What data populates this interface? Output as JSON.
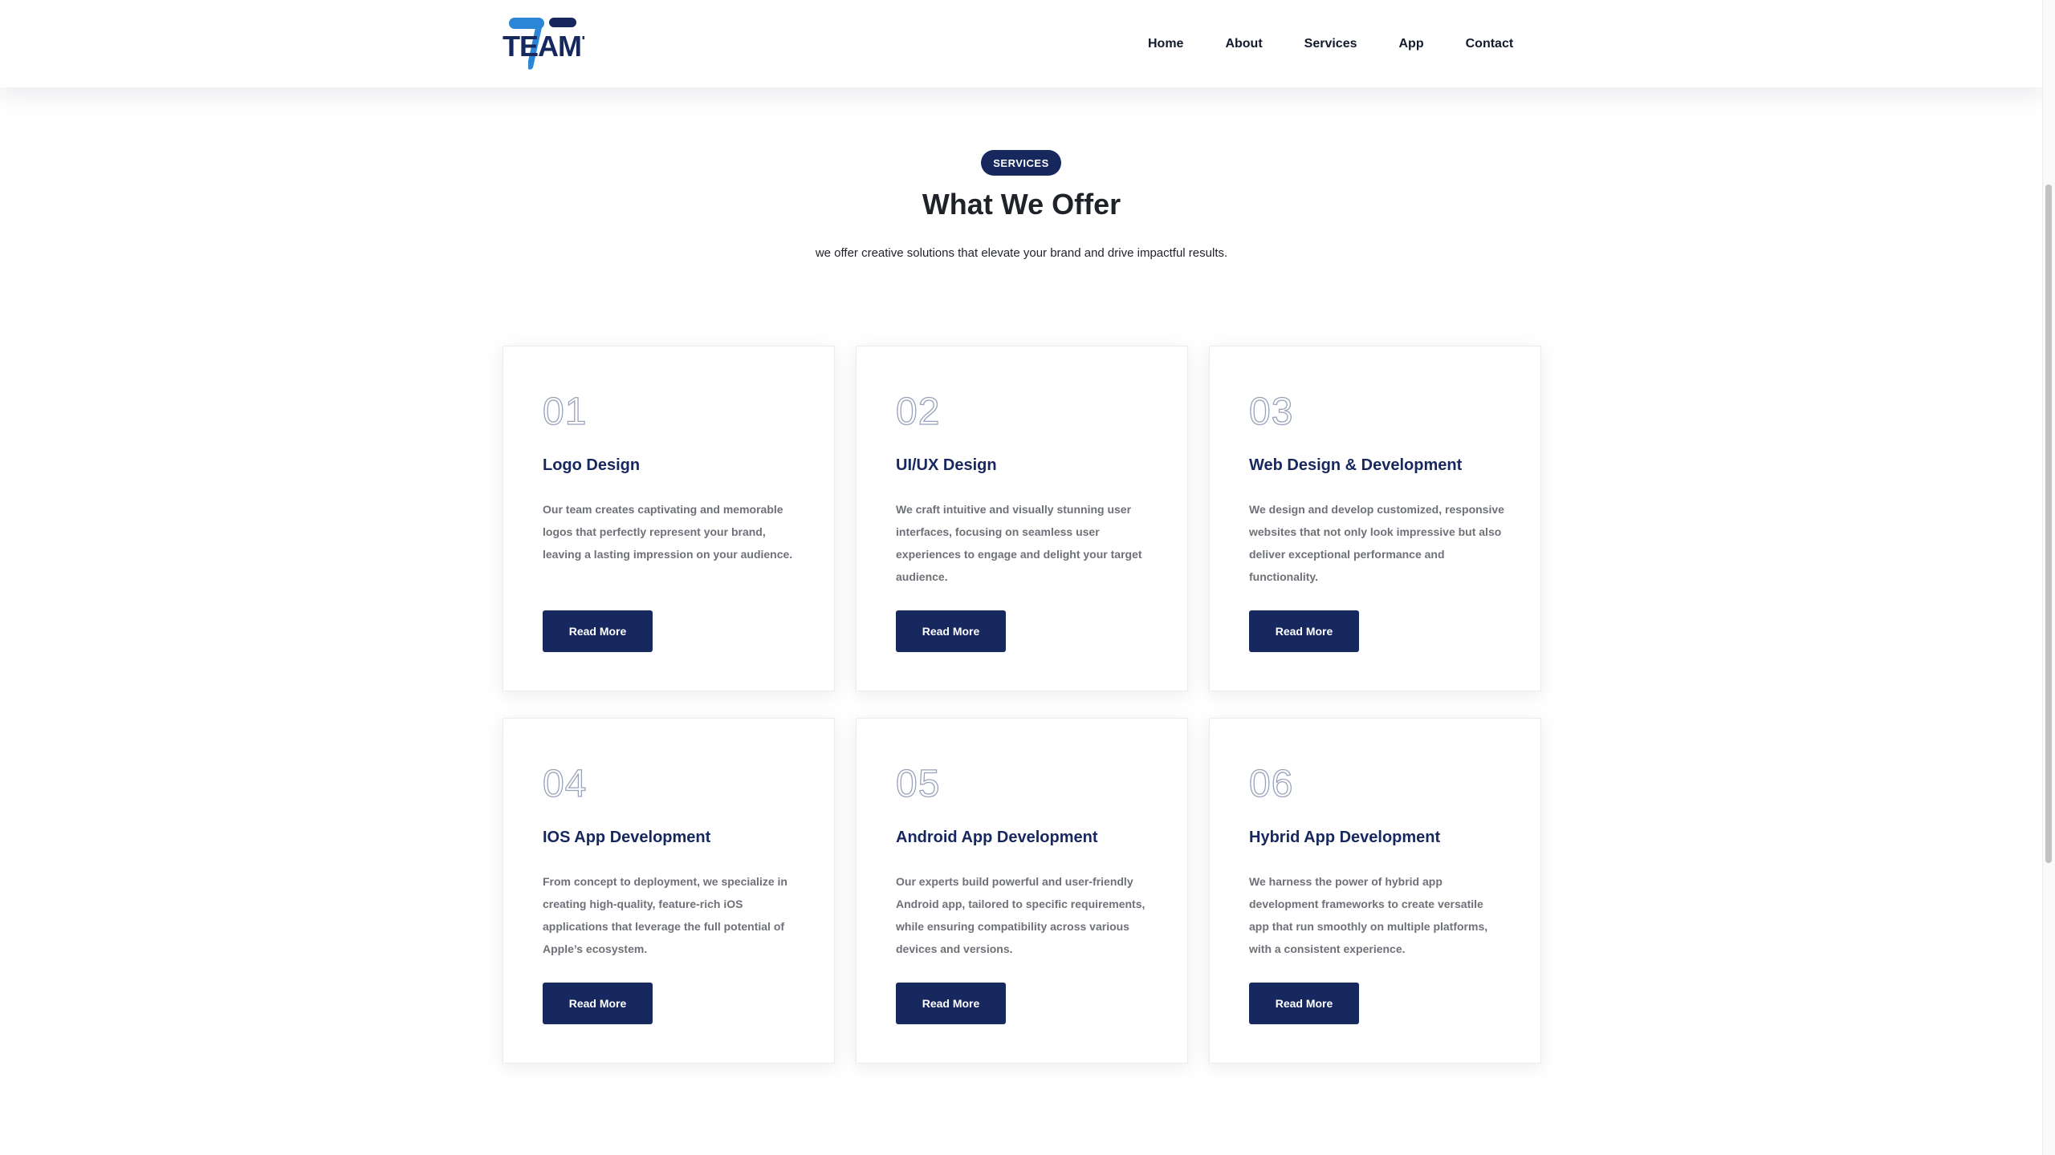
{
  "brand": {
    "logo_text": "TEAM7",
    "logo_colors": {
      "primary": "#17285e",
      "accent": "#2b86d8"
    }
  },
  "nav": {
    "items": [
      {
        "label": "Home"
      },
      {
        "label": "About"
      },
      {
        "label": "Services"
      },
      {
        "label": "App"
      },
      {
        "label": "Contact"
      }
    ]
  },
  "section": {
    "badge": "SERVICES",
    "title": "What We Offer",
    "subtitle": "we offer creative solutions that elevate your brand and drive impactful results."
  },
  "cards": [
    {
      "number": "01",
      "title": "Logo Design",
      "description": "Our team creates captivating and memorable logos that perfectly represent your brand, leaving a lasting impression on your audience.",
      "button": "Read More"
    },
    {
      "number": "02",
      "title": "UI/UX Design",
      "description": "We craft intuitive and visually stunning user interfaces, focusing on seamless user experiences to engage and delight your target audience.",
      "button": "Read More"
    },
    {
      "number": "03",
      "title": "Web Design & Development",
      "description": "We design and develop customized, responsive websites that not only look impressive but also deliver exceptional performance and functionality.",
      "button": "Read More"
    },
    {
      "number": "04",
      "title": "IOS App Development",
      "description": "From concept to deployment, we specialize in creating high-quality, feature-rich iOS applications that leverage the full potential of Apple’s ecosystem.",
      "button": "Read More"
    },
    {
      "number": "05",
      "title": "Android App Development",
      "description": "Our experts build powerful and user-friendly Android app, tailored to specific requirements, while ensuring compatibility across various devices and versions.",
      "button": "Read More"
    },
    {
      "number": "06",
      "title": "Hybrid App Development",
      "description": "We harness the power of hybrid app development frameworks to create versatile app that run smoothly on multiple platforms, with a consistent experience.",
      "button": "Read More"
    }
  ],
  "colors": {
    "primary": "#17285e",
    "text": "#1f2229",
    "muted": "#6f7178",
    "outline_number": "#9aa2ba"
  }
}
